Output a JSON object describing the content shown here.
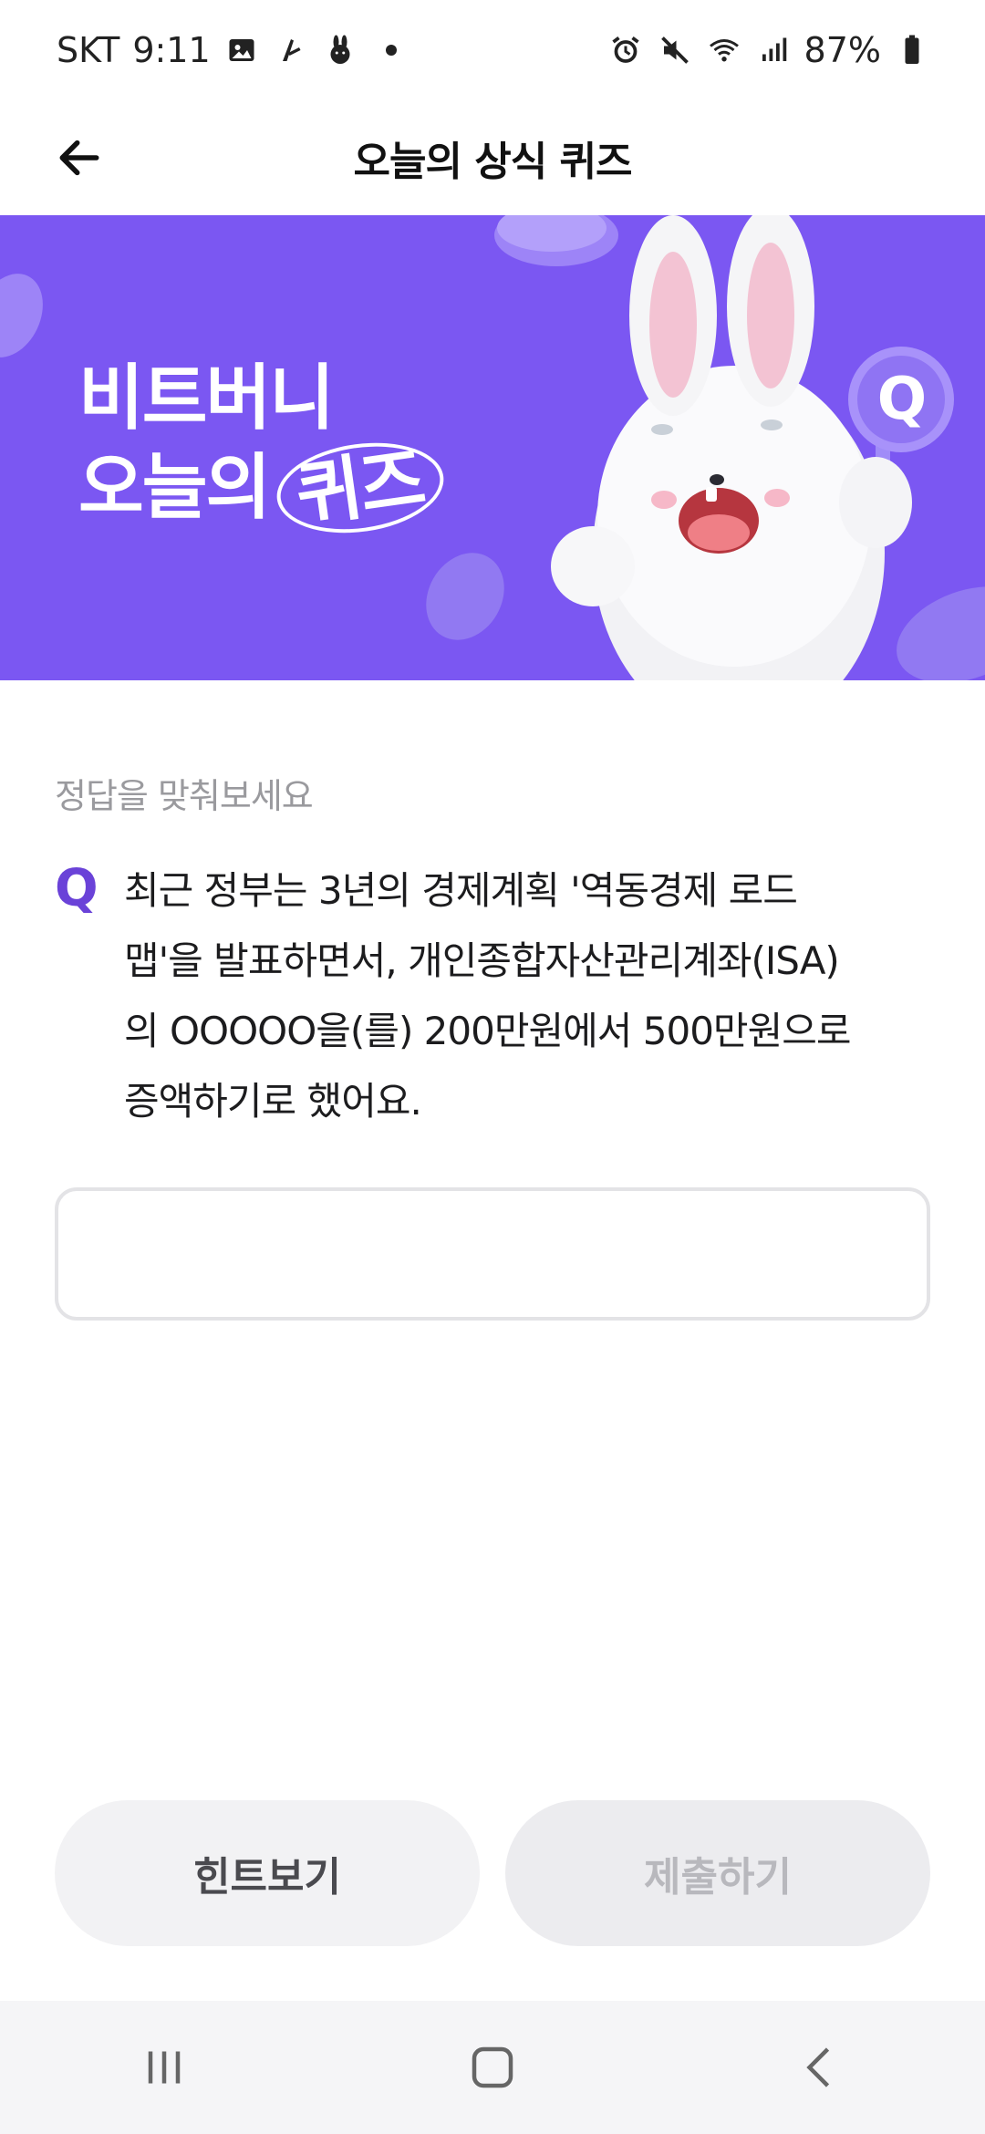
{
  "status_bar": {
    "carrier": "SKT",
    "time": "9:11",
    "battery": "87%"
  },
  "app_bar": {
    "title": "오늘의 상식 퀴즈"
  },
  "banner": {
    "line1": "비트버니",
    "line2_prefix": "오늘의",
    "line2_highlight": "퀴즈",
    "badge": "Q",
    "colors": {
      "background": "#7b57f2"
    }
  },
  "quiz": {
    "prompt_label": "정답을 맞춰보세요",
    "q_mark": "Q",
    "question_lines": [
      "최근 정부는 3년의 경제계획 '역동경제 로드",
      "맵'을 발표하면서, 개인종합자산관리계좌(ISA)",
      "의 OOOOO을(를) 200만원에서 500만원으로",
      "증액하기로 했어요."
    ],
    "answer_value": "",
    "answer_placeholder": ""
  },
  "actions": {
    "hint_label": "힌트보기",
    "submit_label": "제출하기"
  },
  "colors": {
    "accent": "#6a42d8",
    "banner": "#7b57f2"
  }
}
